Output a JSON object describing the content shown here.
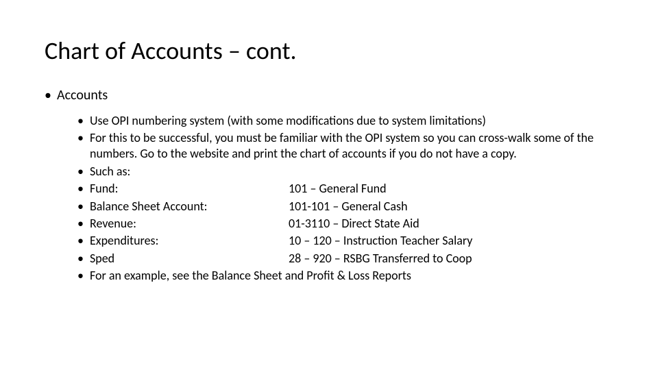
{
  "title": "Chart of Accounts – cont.",
  "level1": "Accounts",
  "items": [
    {
      "text": "Use OPI numbering system (with some modifications due to system limitations)"
    },
    {
      "text": "For this to be successful, you must be familiar with the OPI system so you can cross-walk some of the numbers. Go to the website and print the chart of accounts if you do not have a copy."
    },
    {
      "text": "Such as:"
    },
    {
      "label": "Fund:",
      "value": "101 – General Fund"
    },
    {
      "label": "Balance Sheet Account:",
      "value": "101-101 – General Cash"
    },
    {
      "label": "Revenue:",
      "value": "01-3110 – Direct State Aid"
    },
    {
      "label": "Expenditures:",
      "value": "10 – 120 – Instruction Teacher Salary"
    },
    {
      "label": "Sped",
      "value": "28 – 920 – RSBG Transferred to Coop"
    },
    {
      "text": "For an example, see the Balance Sheet and Profit & Loss Reports"
    }
  ]
}
